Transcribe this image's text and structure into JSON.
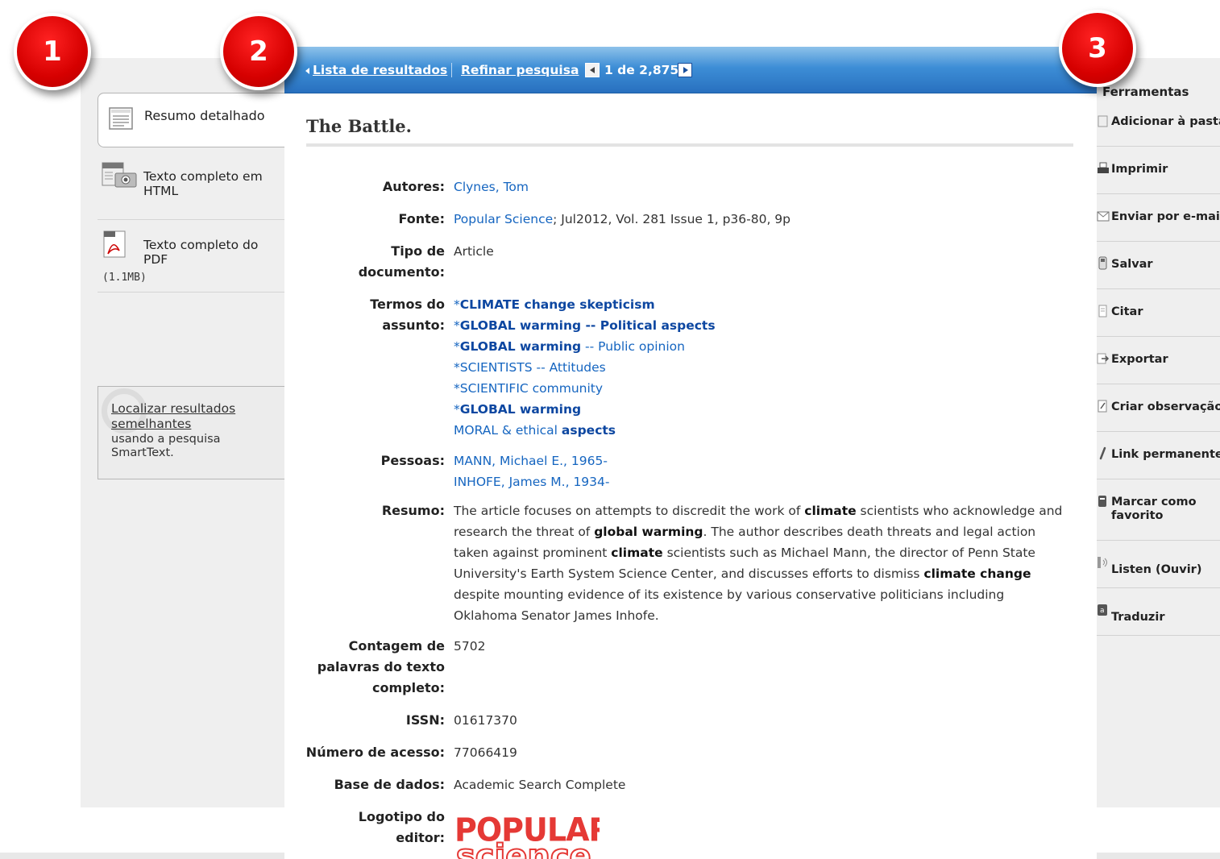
{
  "left_formats": {
    "detailed": "Resumo detalhado",
    "html_fulltext": "Texto completo em HTML",
    "pdf_fulltext": "Texto completo do PDF",
    "pdf_size": "(1.1MB)"
  },
  "similar": {
    "link": "Localizar resultados semelhantes",
    "description": "usando a pesquisa SmartText."
  },
  "topbar": {
    "results_list": "Lista de resultados",
    "refine": "Refinar pesquisa",
    "pagination": "1 de 2,875"
  },
  "record": {
    "title": "The Battle.",
    "labels": {
      "authors": "Autores:",
      "source": "Fonte:",
      "doc_type_1": "Tipo de",
      "doc_type_2": "documento:",
      "subject_1": "Termos do",
      "subject_2": "assunto:",
      "people": "Pessoas:",
      "abstract": "Resumo:",
      "wordcount_1": "Contagem de",
      "wordcount_2": "palavras do texto",
      "wordcount_3": "completo:",
      "issn": "ISSN:",
      "accession": "Número de acesso:",
      "database": "Base de dados:",
      "logo_1": "Logotipo do",
      "logo_2": "editor:"
    },
    "author": "Clynes, Tom",
    "source_link": "Popular Science",
    "source_rest": "; Jul2012, Vol. 281 Issue 1, p36-80, 9p",
    "doc_type": "Article",
    "subjects": {
      "s1_prefix": "*",
      "s1_bold": "CLIMATE change skepticism",
      "s2_prefix": "*",
      "s2_bold": "GLOBAL warming -- Political aspects",
      "s3_prefix": "*",
      "s3_bold": "GLOBAL warming",
      "s3_rest": " -- Public opinion",
      "s4": "*SCIENTISTS -- Attitudes",
      "s5": "*SCIENTIFIC community",
      "s6_prefix": "*",
      "s6_bold": "GLOBAL warming",
      "s7_plain": "MORAL & ethical ",
      "s7_bold": "aspects"
    },
    "people": [
      "MANN, Michael E., 1965-",
      "INHOFE, James M., 1934-"
    ],
    "abstract": {
      "p1": "The article focuses on attempts to discredit the work of ",
      "b1": "climate",
      "p2": " scientists who acknowledge and research the threat of ",
      "b2": "global warming",
      "p3": ". The author describes death threats and legal action taken against prominent ",
      "b3": "climate",
      "p4": " scientists such as Michael Mann, the director of Penn State University's Earth System Science Center, and discusses efforts to dismiss ",
      "b4": "climate change",
      "p5": " despite mounting evidence of its existence by various conservative politicians including Oklahoma Senator James Inhofe."
    },
    "word_count": "5702",
    "issn": "01617370",
    "accession": "77066419",
    "database": "Academic Search Complete",
    "publisher_logo": [
      "POPULAR",
      "science"
    ]
  },
  "tools": {
    "heading": "Ferramentas",
    "items": [
      {
        "label": "Adicionar à pasta",
        "icon": "folder-icon"
      },
      {
        "label": "Imprimir",
        "icon": "printer-icon"
      },
      {
        "label": "Enviar por e-mail",
        "icon": "email-icon"
      },
      {
        "label": "Salvar",
        "icon": "save-icon"
      },
      {
        "label": "Citar",
        "icon": "cite-icon"
      },
      {
        "label": "Exportar",
        "icon": "export-icon"
      },
      {
        "label": "Criar observação",
        "icon": "note-icon"
      },
      {
        "label": "Link permanente",
        "icon": "permalink-icon"
      },
      {
        "label": "Marcar como favorito",
        "icon": "bookmark-icon"
      },
      {
        "label": "Listen (Ouvir)",
        "icon": "listen-icon"
      },
      {
        "label": "Traduzir",
        "icon": "translate-icon"
      }
    ]
  },
  "badges": [
    "1",
    "2",
    "3"
  ],
  "colors": {
    "topbar": "#2870bf",
    "link": "#1565c0",
    "badge": "#d60000"
  }
}
